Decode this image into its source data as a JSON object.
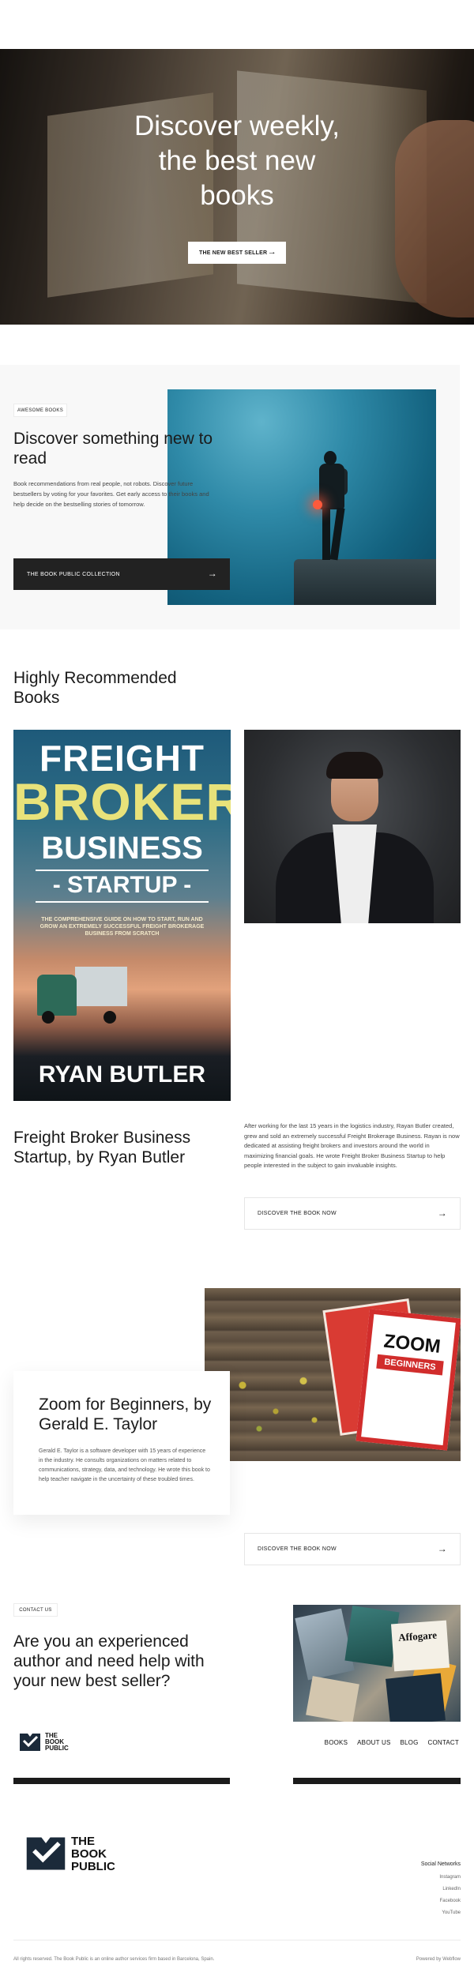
{
  "hero": {
    "title_line1": "Discover weekly,",
    "title_line2": "the best new",
    "title_line3": "books",
    "cta_label": "THE NEW BEST SELLER",
    "cta_arrow": "→"
  },
  "feature": {
    "tag": "AWESOME BOOKS",
    "title": "Discover something new to read",
    "text": "Book recommendations from real people, not robots. Discover future bestsellers by voting for your favorites. Get early access to their books and help decide on the bestselling stories of tomorrow.",
    "cta_label": "THE BOOK PUBLIC COLLECTION",
    "cta_arrow": "→"
  },
  "recommended": {
    "heading": "Highly Recommended Books",
    "book1": {
      "cover_line1": "FREIGHT",
      "cover_line2": "BROKER",
      "cover_line3": "BUSINESS",
      "cover_line4": "- STARTUP -",
      "cover_subtitle": "THE COMPREHENSIVE GUIDE ON HOW TO START, RUN AND GROW AN EXTREMELY SUCCESSFUL FREIGHT BROKERAGE BUSINESS FROM SCRATCH",
      "cover_author": "RYAN BUTLER",
      "title": "Freight Broker Business Startup, by Ryan Butler",
      "text": "After working for the last 15 years in the logistics industry, Rayan Butler created, grew and sold an extremely successful Freight Brokerage Business. Rayan is now dedicated at assisting freight brokers and investors around the world in maximizing financial goals. He wrote Freight Broker Business Startup to help people interested in the subject to gain invaluable insights.",
      "cta_label": "DISCOVER THE BOOK NOW",
      "cta_arrow": "→"
    },
    "book2": {
      "cover_title": "ZOOM",
      "cover_subtitle": "BEGINNERS",
      "title": "Zoom for Beginners, by Gerald E. Taylor",
      "text": "Gerald E. Taylor is a software developer with 15 years of experience in the industry. He consults organizations on matters related to communications, strategy, data, and technology. He wrote this book to help teacher navigate in the uncertainty of these troubled times.",
      "cta_label": "DISCOVER THE BOOK NOW",
      "cta_arrow": "→"
    }
  },
  "contact": {
    "tag": "CONTACT US",
    "title": "Are you an experienced author and need help with your new best seller?",
    "magazine_label": "Affogare"
  },
  "nav": {
    "logo_line1": "THE",
    "logo_line2": "BOOK",
    "logo_line3": "PUBLIC",
    "links": [
      "BOOKS",
      "ABOUT US",
      "BLOG",
      "CONTACT"
    ]
  },
  "footer": {
    "logo_line1": "THE",
    "logo_line2": "BOOK",
    "logo_line3": "PUBLIC",
    "social_heading": "Social Networks",
    "social_links": [
      "Instagram",
      "LinkedIn",
      "Facebook",
      "YouTube"
    ],
    "copyright": "All rights reserved. The Book Public is an online author services firm based in Barcelona, Spain.",
    "powered": "Powered by Webflow"
  },
  "colors": {
    "accent_dark": "#222222",
    "background_light": "#f8f8f8"
  }
}
